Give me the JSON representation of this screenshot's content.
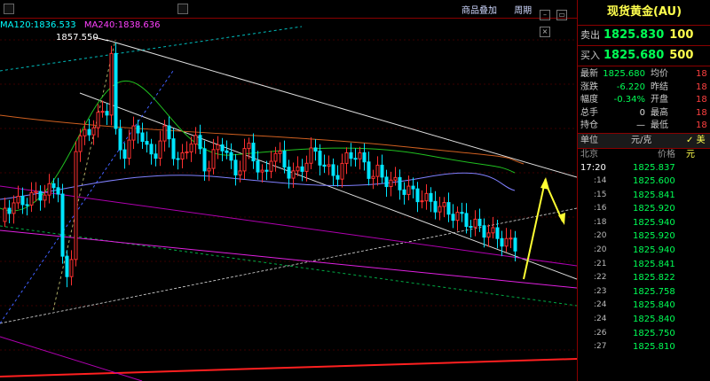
{
  "colors": {
    "up": "#ff3030",
    "down": "#00e5ff",
    "ma120": "#00ffff",
    "ma240": "#ff40ff"
  },
  "topbar": {
    "links": [
      "商品叠加",
      "周期"
    ],
    "icons": [
      "minimize-icon",
      "restore-icon",
      "close-icon"
    ]
  },
  "legend": {
    "ma120": "MA120:1836.533",
    "ma240": "MA240:1838.636"
  },
  "annotations": {
    "high_label": "1857.550"
  },
  "panel": {
    "title": "现货黄金(AU)",
    "sell": {
      "label": "卖出",
      "price": "1825.830",
      "qty": "100"
    },
    "buy": {
      "label": "买入",
      "price": "1825.680",
      "qty": "500"
    },
    "stats": [
      {
        "k1": "最新",
        "v1": "1825.680",
        "k2": "均价",
        "v2": "18"
      },
      {
        "k1": "涨跌",
        "v1": "-6.220",
        "k2": "昨结",
        "v2": "18"
      },
      {
        "k1": "幅度",
        "v1": "-0.34%",
        "k2": "开盘",
        "v2": "18"
      },
      {
        "k1": "总手",
        "v1": "0",
        "k2": "最高",
        "v2": "18"
      },
      {
        "k1": "持仓",
        "v1": "—",
        "k2": "最低",
        "v2": "18"
      }
    ],
    "unit_row": {
      "unit_label": "单位",
      "unit": "元/克",
      "extra": "美元"
    },
    "tick_head": {
      "place": "北京",
      "price": "价格"
    },
    "ticks": [
      {
        "time": "17:20",
        "price": "1825.837"
      },
      {
        "time": ":14",
        "price": "1825.600"
      },
      {
        "time": ":15",
        "price": "1825.841"
      },
      {
        "time": ":16",
        "price": "1825.920"
      },
      {
        "time": ":18",
        "price": "1825.940"
      },
      {
        "time": ":20",
        "price": "1825.920"
      },
      {
        "time": ":20",
        "price": "1825.940"
      },
      {
        "time": ":21",
        "price": "1825.841"
      },
      {
        "time": ":22",
        "price": "1825.822"
      },
      {
        "time": ":23",
        "price": "1825.758"
      },
      {
        "time": ":24",
        "price": "1825.840"
      },
      {
        "time": ":24",
        "price": "1825.840"
      },
      {
        "time": ":26",
        "price": "1825.750"
      },
      {
        "time": ":27",
        "price": "1825.810"
      }
    ]
  }
}
